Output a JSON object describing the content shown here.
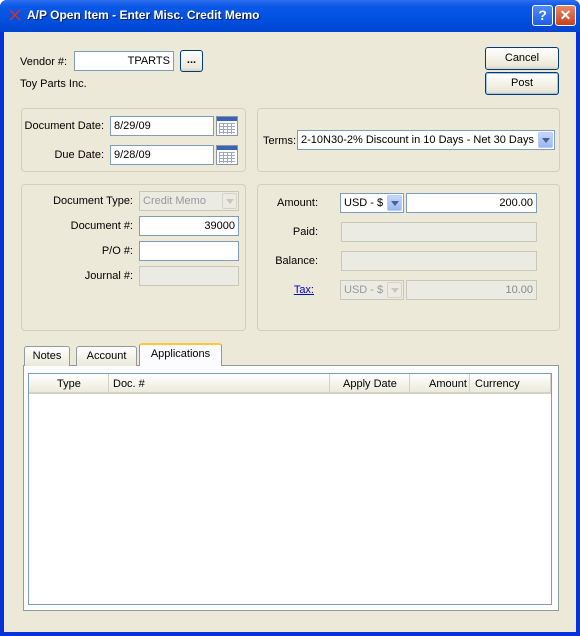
{
  "window": {
    "title": "A/P Open Item - Enter Misc. Credit Memo",
    "help_glyph": "?",
    "close_glyph": "✕"
  },
  "vendor": {
    "label": "Vendor #:",
    "value": "TPARTS",
    "lookup_label": "...",
    "name": "Toy Parts Inc."
  },
  "actions": {
    "cancel": "Cancel",
    "post": "Post"
  },
  "dates": {
    "document_date_label": "Document Date:",
    "document_date": "8/29/09",
    "due_date_label": "Due Date:",
    "due_date": "9/28/09"
  },
  "terms": {
    "label": "Terms:",
    "value": "2-10N30-2% Discount in 10 Days - Net 30 Days"
  },
  "document": {
    "type_label": "Document Type:",
    "type_value": "Credit Memo",
    "number_label": "Document #:",
    "number_value": "39000",
    "po_label": "P/O #:",
    "po_value": "",
    "journal_label": "Journal #:",
    "journal_value": ""
  },
  "amounts": {
    "amount_label": "Amount:",
    "currency": "USD - $",
    "amount": "200.00",
    "paid_label": "Paid:",
    "paid": "",
    "balance_label": "Balance:",
    "balance": "",
    "tax_label": "Tax:",
    "tax_currency": "USD - $",
    "tax": "10.00"
  },
  "tabs": [
    {
      "label": "Notes"
    },
    {
      "label": "Account"
    },
    {
      "label": "Applications"
    }
  ],
  "applications": {
    "columns": [
      "Type",
      "Doc. #",
      "Apply Date",
      "Amount",
      "Currency"
    ],
    "rows": []
  }
}
